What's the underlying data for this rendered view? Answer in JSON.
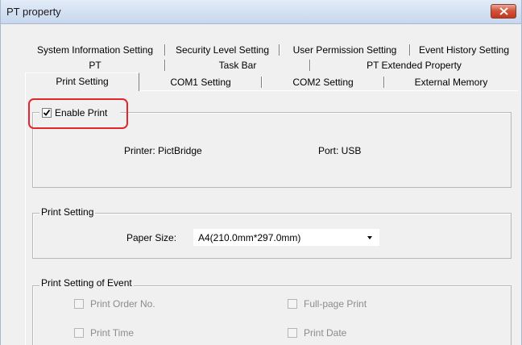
{
  "window": {
    "title": "PT property"
  },
  "tabs": {
    "row1": [
      "System Information Setting",
      "Security Level Setting",
      "User Permission Setting",
      "Event History Setting"
    ],
    "row2": [
      "PT",
      "Task Bar",
      "PT Extended Property"
    ],
    "row3": [
      "Print Setting",
      "COM1 Setting",
      "COM2 Setting",
      "External Memory"
    ],
    "active": "Print Setting"
  },
  "enable_print": {
    "label": "Enable Print",
    "checked": true
  },
  "printer": {
    "printer_label": "Printer: PictBridge",
    "port_label": "Port: USB"
  },
  "print_setting": {
    "legend": "Print Setting",
    "paper_size_label": "Paper Size:",
    "paper_size_value": "A4(210.0mm*297.0mm)"
  },
  "print_event": {
    "legend": "Print Setting of Event",
    "options": [
      "Print Order No.",
      "Full-page Print",
      "Print Time",
      "Print Date"
    ]
  },
  "colors": {
    "highlight": "#e3262e",
    "titlebar": "#d4e1f2",
    "close": "#c2371f"
  }
}
